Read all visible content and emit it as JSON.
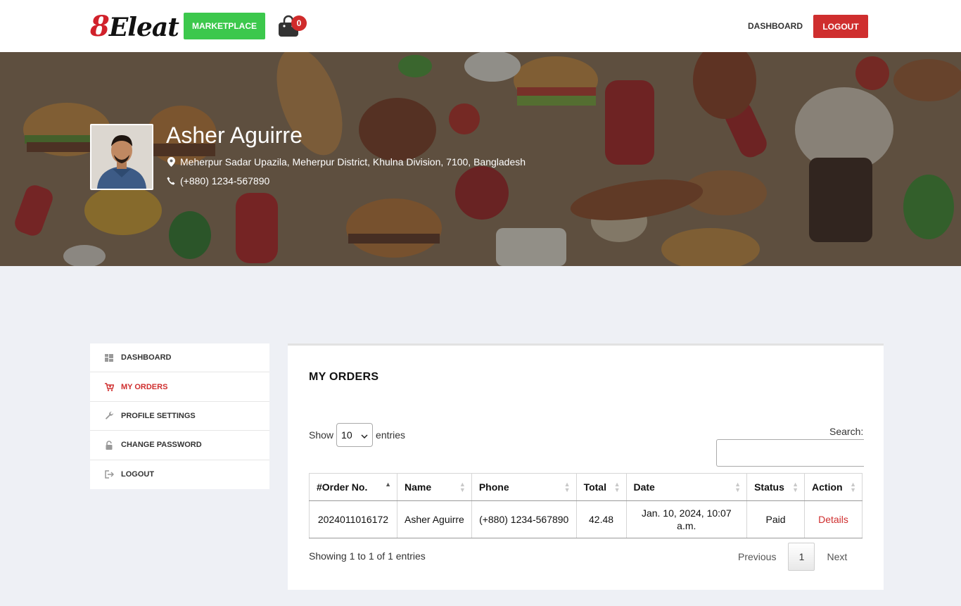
{
  "header": {
    "logo_prefix": "8",
    "logo_text": "Eleat",
    "marketplace_label": "MARKETPLACE",
    "cart_count": "0",
    "dashboard_label": "DASHBOARD",
    "logout_label": "LOGOUT"
  },
  "profile": {
    "name": "Asher Aguirre",
    "address": "Meherpur Sadar Upazila, Meherpur District, Khulna Division, 7100, Bangladesh",
    "phone": "(+880) 1234-567890"
  },
  "sidebar": {
    "items": [
      {
        "label": "DASHBOARD",
        "icon": "dashboard-icon",
        "active": false
      },
      {
        "label": "MY ORDERS",
        "icon": "cart-icon",
        "active": true
      },
      {
        "label": "PROFILE SETTINGS",
        "icon": "wrench-icon",
        "active": false
      },
      {
        "label": "CHANGE PASSWORD",
        "icon": "lock-icon",
        "active": false
      },
      {
        "label": "LOGOUT",
        "icon": "sign-out-icon",
        "active": false
      }
    ]
  },
  "orders": {
    "title": "MY ORDERS",
    "show_label": "Show",
    "entries_value": "10",
    "entries_label": "entries",
    "search_label": "Search:",
    "columns": [
      "#Order No.",
      "Name",
      "Phone",
      "Total",
      "Date",
      "Status",
      "Action"
    ],
    "rows": [
      {
        "order_no": "2024011016172",
        "name": "Asher Aguirre",
        "phone": "(+880) 1234-567890",
        "total": "42.48",
        "date": "Jan. 10, 2024, 10:07 a.m.",
        "status": "Paid",
        "action": "Details"
      }
    ],
    "showing_text": "Showing 1 to 1 of 1 entries",
    "pager": {
      "previous": "Previous",
      "current_page": "1",
      "next": "Next"
    }
  },
  "colors": {
    "accent_red": "#cf2e2e",
    "marketplace_green": "#3cc84c",
    "page_bg": "#eef0f5"
  }
}
